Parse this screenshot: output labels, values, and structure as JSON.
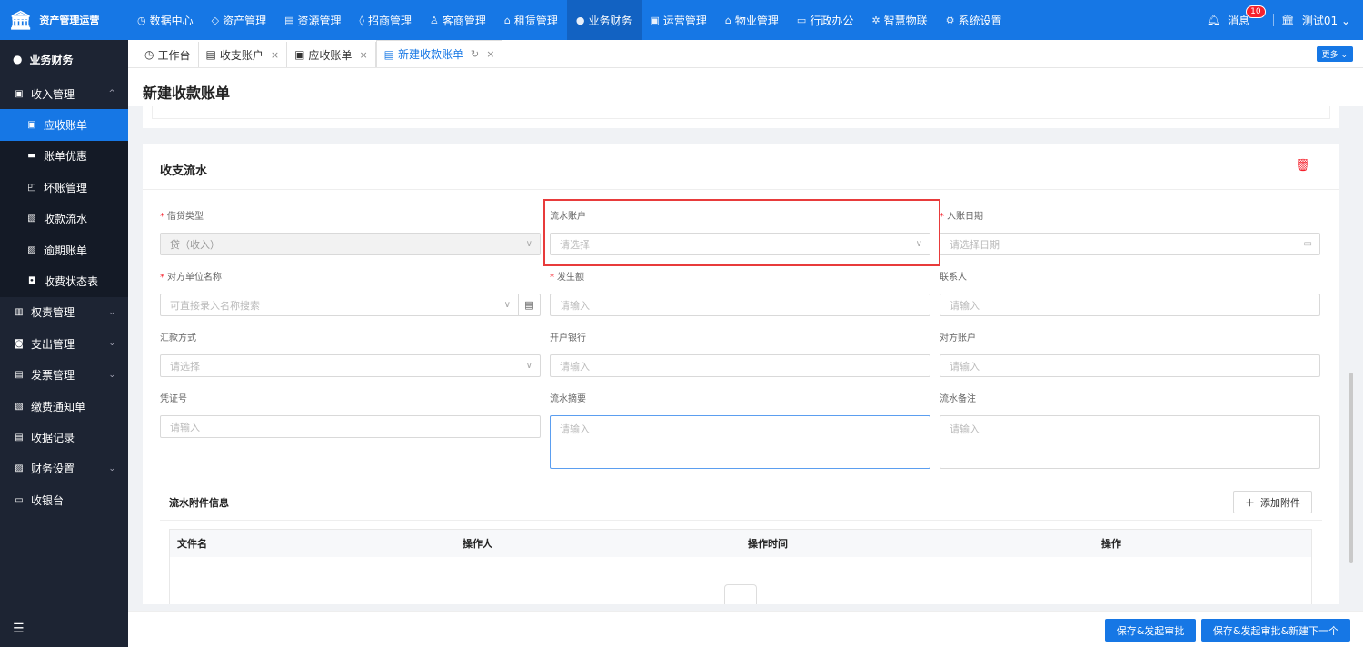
{
  "app": {
    "title": "资产管理运营"
  },
  "topnav": [
    {
      "label": "数据中心",
      "icon": "clock-icon",
      "glyph": "◷"
    },
    {
      "label": "资产管理",
      "icon": "cube-icon",
      "glyph": "◇"
    },
    {
      "label": "资源管理",
      "icon": "building-icon",
      "glyph": "▤"
    },
    {
      "label": "招商管理",
      "icon": "tag-icon",
      "glyph": "◊"
    },
    {
      "label": "客商管理",
      "icon": "users-icon",
      "glyph": "♙"
    },
    {
      "label": "租赁管理",
      "icon": "house-icon",
      "glyph": "⌂"
    },
    {
      "label": "业务财务",
      "icon": "finance-icon",
      "glyph": "●",
      "active": true
    },
    {
      "label": "运营管理",
      "icon": "chart-icon",
      "glyph": "▣"
    },
    {
      "label": "物业管理",
      "icon": "property-icon",
      "glyph": "⌂"
    },
    {
      "label": "行政办公",
      "icon": "monitor-icon",
      "glyph": "▭"
    },
    {
      "label": "智慧物联",
      "icon": "iot-icon",
      "glyph": "✲"
    },
    {
      "label": "系统设置",
      "icon": "gear-icon",
      "glyph": "⚙"
    }
  ],
  "topright": {
    "messages_label": "消息",
    "messages_count": "10",
    "user": "测试01"
  },
  "sidebar": {
    "header": "业务财务",
    "items": [
      {
        "label": "收入管理",
        "icon": "income-icon",
        "glyph": "▣",
        "chev": "^"
      },
      {
        "label": "应收账单",
        "icon": "receivable-icon",
        "glyph": "▣",
        "sub": true,
        "active": true
      },
      {
        "label": "账单优惠",
        "icon": "discount-icon",
        "glyph": "▬",
        "sub": true
      },
      {
        "label": "坏账管理",
        "icon": "bad-debt-icon",
        "glyph": "◰",
        "sub": true
      },
      {
        "label": "收款流水",
        "icon": "payment-flow-icon",
        "glyph": "▧",
        "sub": true
      },
      {
        "label": "逾期账单",
        "icon": "overdue-icon",
        "glyph": "▨",
        "sub": true
      },
      {
        "label": "收费状态表",
        "icon": "status-table-icon",
        "glyph": "◘",
        "sub": true
      },
      {
        "label": "权责管理",
        "icon": "accrual-icon",
        "glyph": "▥",
        "chev": "⌄"
      },
      {
        "label": "支出管理",
        "icon": "expense-icon",
        "glyph": "◙",
        "chev": "⌄"
      },
      {
        "label": "发票管理",
        "icon": "invoice-icon",
        "glyph": "▤",
        "chev": "⌄"
      },
      {
        "label": "缴费通知单",
        "icon": "notice-icon",
        "glyph": "▧"
      },
      {
        "label": "收据记录",
        "icon": "receipt-icon",
        "glyph": "▤"
      },
      {
        "label": "财务设置",
        "icon": "finance-settings-icon",
        "glyph": "▨",
        "chev": "⌄"
      },
      {
        "label": "收银台",
        "icon": "cashier-icon",
        "glyph": "▭"
      }
    ]
  },
  "tabs": [
    {
      "label": "工作台",
      "icon": "dashboard-icon",
      "glyph": "◷"
    },
    {
      "label": "收支账户",
      "icon": "account-icon",
      "glyph": "▤",
      "close": "×"
    },
    {
      "label": "应收账单",
      "icon": "bill-icon",
      "glyph": "▣",
      "close": "×"
    },
    {
      "label": "新建收款账单",
      "icon": "new-bill-icon",
      "glyph": "▤",
      "close": "×",
      "refresh": "↻",
      "active": true
    }
  ],
  "more_label": "更多 ⌄",
  "page_title": "新建收款账单",
  "section": {
    "title": "收支流水",
    "fields": {
      "credit_type": {
        "label": "借贷类型",
        "value": "贷（收入）"
      },
      "flow_account": {
        "label": "流水账户",
        "placeholder": "请选择"
      },
      "entry_date": {
        "label": "入账日期",
        "placeholder": "请选择日期"
      },
      "counterparty": {
        "label": "对方单位名称",
        "placeholder": "可直接录入名称搜索"
      },
      "amount": {
        "label": "发生额",
        "placeholder": "请输入"
      },
      "contact": {
        "label": "联系人",
        "placeholder": "请输入"
      },
      "remit_method": {
        "label": "汇款方式",
        "placeholder": "请选择"
      },
      "bank": {
        "label": "开户银行",
        "placeholder": "请输入"
      },
      "counter_account": {
        "label": "对方账户",
        "placeholder": "请输入"
      },
      "voucher_no": {
        "label": "凭证号",
        "placeholder": "请输入"
      },
      "flow_summary": {
        "label": "流水摘要",
        "placeholder": "请输入"
      },
      "flow_remark": {
        "label": "流水备注",
        "placeholder": "请输入"
      }
    },
    "attachments": {
      "title": "流水附件信息",
      "add_label": "添加附件",
      "columns": [
        "文件名",
        "操作人",
        "操作时间",
        "操作"
      ]
    }
  },
  "footer": {
    "save_submit": "保存&发起审批",
    "save_submit_new": "保存&发起审批&新建下一个"
  }
}
